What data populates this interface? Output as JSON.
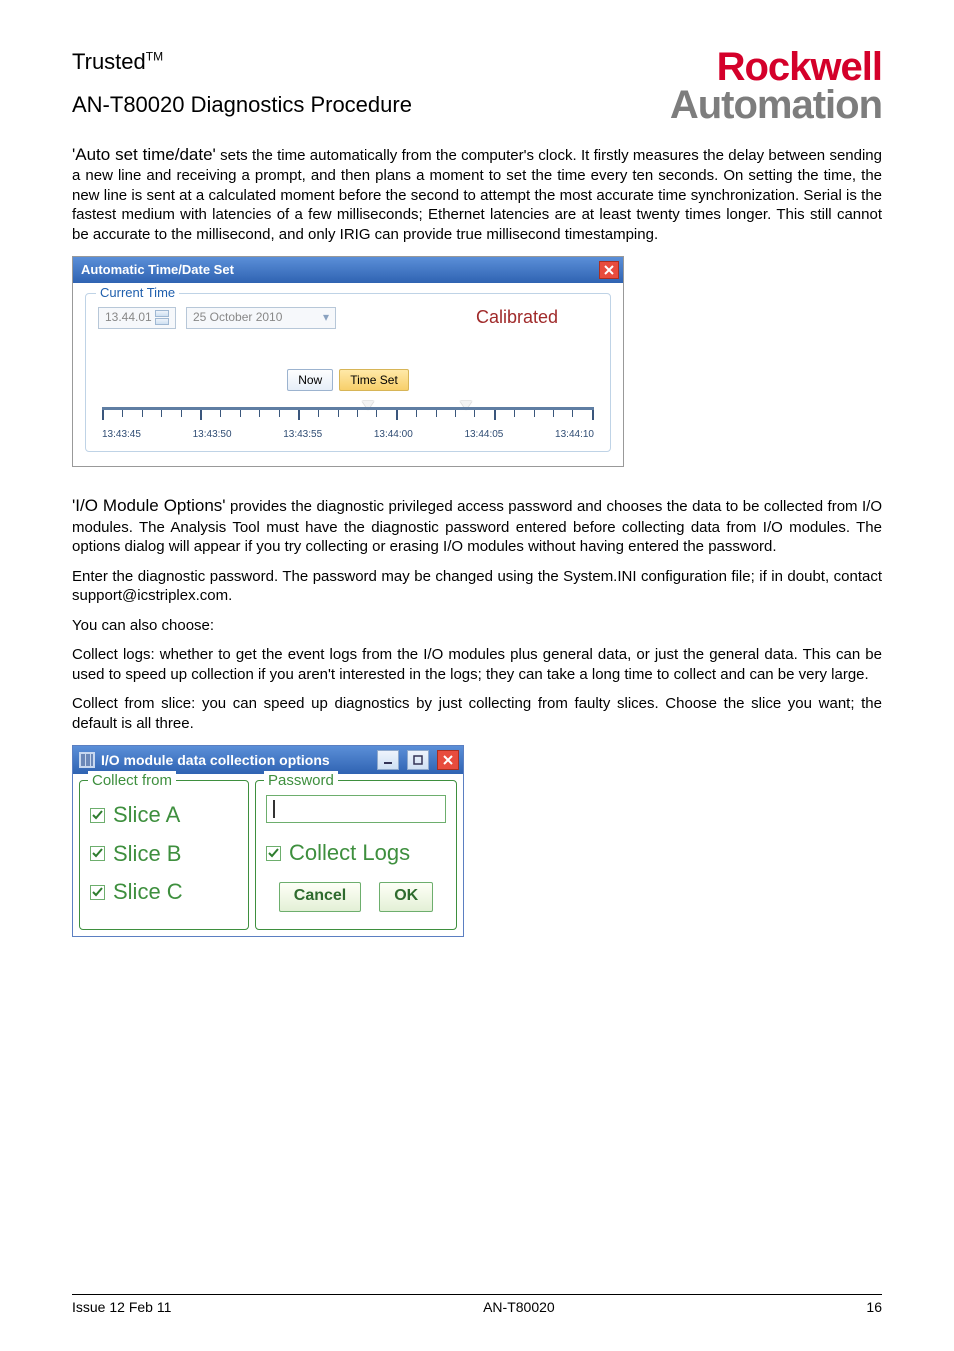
{
  "header": {
    "brand": "Trusted",
    "tm": "TM",
    "subtitle": "AN-T80020 Diagnostics Procedure",
    "logo_top": "Rockwell",
    "logo_bottom": "Automation"
  },
  "p_auto_head": "'Auto set time/date'",
  "p_auto_body": " sets the time automatically from the computer's clock. It firstly measures the delay between sending a new line and receiving a prompt, and then plans a moment to set the time every ten seconds. On setting the time, the new line is sent at a calculated moment before the second to attempt the most accurate time synchronization. Serial is the fastest medium with latencies of a few milliseconds; Ethernet latencies are at least twenty times longer. This still cannot be accurate to the millisecond, and only IRIG can provide true millisecond timestamping.",
  "atd": {
    "title": "Automatic Time/Date Set",
    "legend": "Current Time",
    "time_value": "13.44.01",
    "date_value": "25  October   2010",
    "calibrated": "Calibrated",
    "btn_now": "Now",
    "btn_timeset": "Time Set",
    "labels": [
      "13:43:45",
      "13:43:50",
      "13:43:55",
      "13:44:00",
      "13:44:05",
      "13:44:10"
    ]
  },
  "p_io_head": "'I/O Module Options'",
  "p_io_body": " provides the diagnostic privileged access password and chooses the data to be collected from I/O modules. The Analysis Tool must have the diagnostic password entered before collecting data from I/O modules. The options dialog will appear if you try collecting or erasing I/O modules without having entered the password.",
  "p_pwd": "Enter the diagnostic password. The password may be changed using the System.INI configuration file; if in doubt, contact support@icstriplex.com.",
  "p_choose": "You can also choose:",
  "p_collect_logs": "Collect logs: whether to get the event logs from the I/O modules plus general data, or just the general data. This can be used to speed up collection if you aren't interested in the logs; they can take a long time to collect and can be very large.",
  "p_collect_slice": "Collect from slice: you can speed up diagnostics by just collecting from faulty slices. Choose the slice you want; the default is all three.",
  "io": {
    "title": "I/O module data collection options",
    "legend_left": "Collect from",
    "legend_right": "Password",
    "slice_a": "Slice A",
    "slice_b": "Slice B",
    "slice_c": "Slice C",
    "collect_logs": "Collect Logs",
    "cancel": "Cancel",
    "ok": "OK"
  },
  "footer": {
    "left": "Issue 12 Feb 11",
    "center": "AN-T80020",
    "right": "16"
  }
}
